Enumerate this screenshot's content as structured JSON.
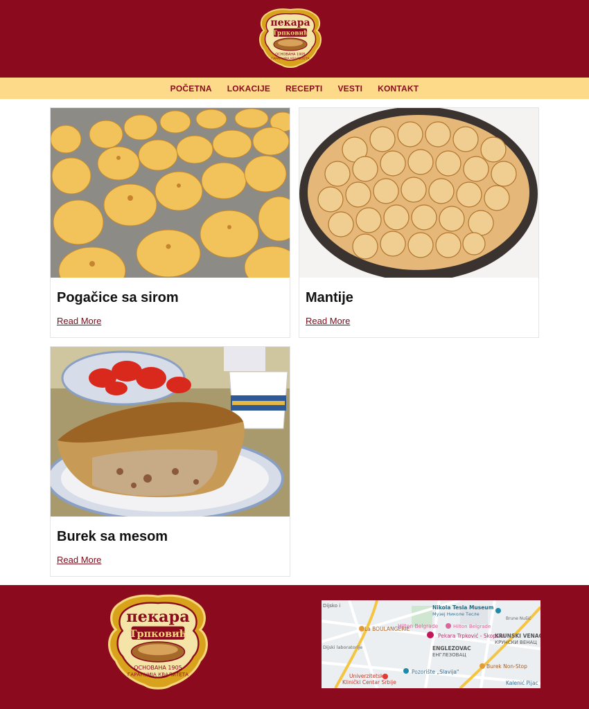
{
  "header": {
    "logo_title": "пекара",
    "logo_name": "Трпковић",
    "logo_tagline_1": "ОСНОВАНА 1905",
    "logo_tagline_2": "ГАРАНЦИЈА КВАЛИТЕТА"
  },
  "nav": {
    "items": [
      {
        "label": "POČETNA"
      },
      {
        "label": "LOKACIJE"
      },
      {
        "label": "RECEPTI"
      },
      {
        "label": "VESTI"
      },
      {
        "label": "KONTAKT"
      }
    ]
  },
  "posts": [
    {
      "title": "Pogačice sa sirom",
      "link": "Read More"
    },
    {
      "title": "Mantije",
      "link": "Read More"
    },
    {
      "title": "Burek sa mesom",
      "link": "Read More"
    }
  ],
  "footer": {
    "map_labels": {
      "museum": "Nikola Tesla Museum",
      "museum_cyr": "Музеј Николе Тесле",
      "hilton": "Hilton Belgrade",
      "hilton_small": "Hilton Belgrade",
      "boulangerie": "La BOULANGERIE",
      "pekara": "Pekara Trpković - Skopska",
      "krunski": "KRUNSKI VENAC",
      "krunski_cyr": "КРУНСКИ ВЕНАЦ",
      "englezovac": "ENGLEZOVAC",
      "englezovac_cyr": "ЕНГЛЕЗОВАЦ",
      "lab": "Dijski laboratorije",
      "klinicki_1": "Univerzitetski",
      "klinicki_2": "Klinički Centar Srbije",
      "pozoriste": "Pozorište „Slavija\"",
      "burek": "Burek Non-Stop",
      "kalenic": "Kalenić Pijac",
      "street": "Brune Nušić",
      "top_left": "Dijsko i"
    }
  },
  "colors": {
    "brand_red": "#8c0a1e",
    "nav_bg": "#fdd98a",
    "link": "#7a0a18"
  }
}
